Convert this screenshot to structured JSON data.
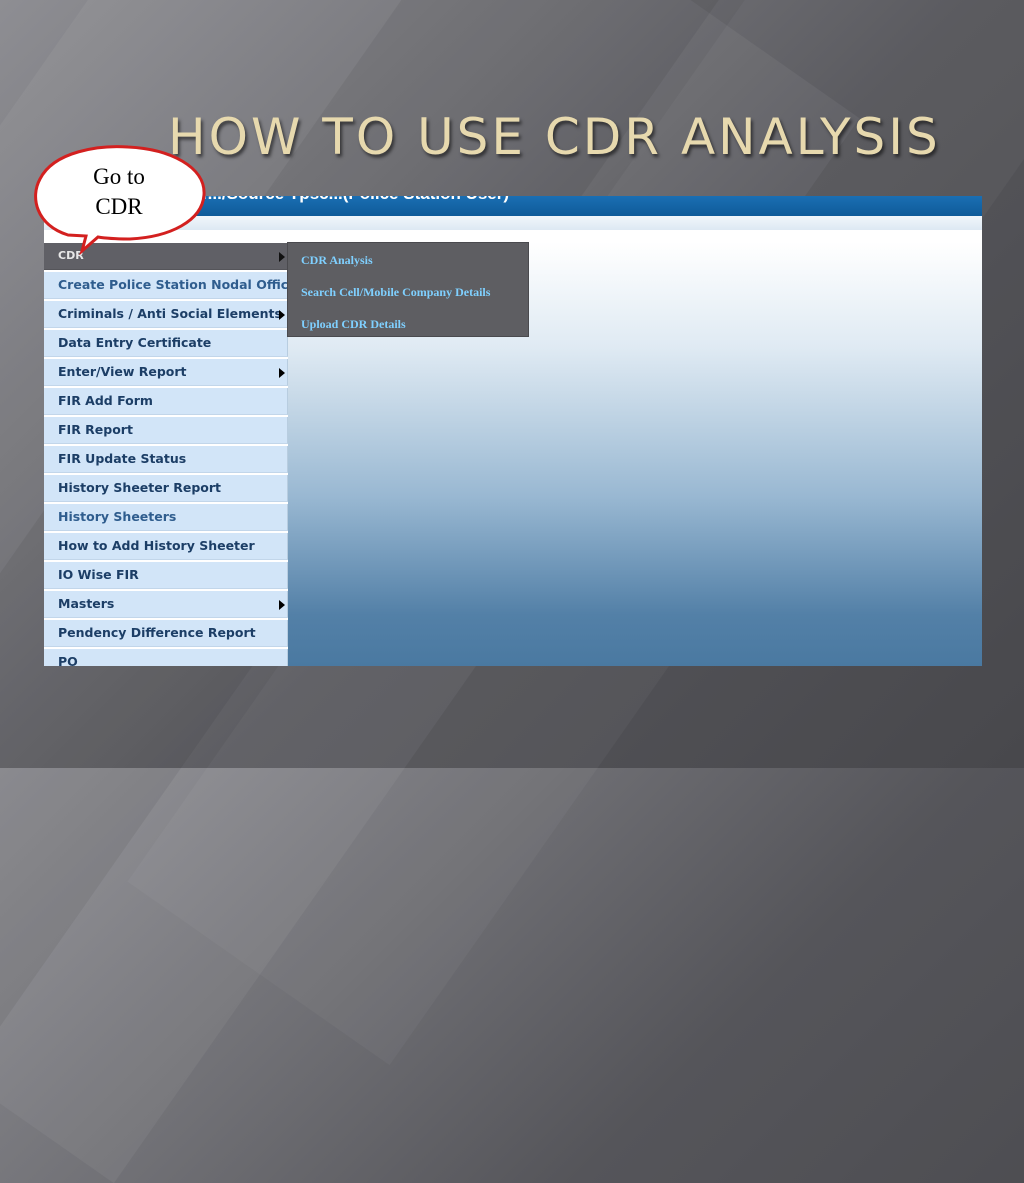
{
  "slide": {
    "title": "HOW TO USE CDR ANALYSIS"
  },
  "callout": {
    "line1": "Go to",
    "line2": "CDR",
    "border_color": "#d3201f"
  },
  "app": {
    "header_partial_text": "r.../Source Tpsc...(Police Station User)",
    "header_color": "#1566a8"
  },
  "sidebar": {
    "items": [
      {
        "label": "CDR",
        "has_submenu": true,
        "active": true
      },
      {
        "label": "Create Police Station Nodal Officer",
        "has_submenu": false
      },
      {
        "label": "Criminals / Anti Social Elements",
        "has_submenu": true
      },
      {
        "label": "Data Entry Certificate",
        "has_submenu": false
      },
      {
        "label": "Enter/View Report",
        "has_submenu": true
      },
      {
        "label": "FIR Add Form",
        "has_submenu": false
      },
      {
        "label": "FIR Report",
        "has_submenu": false
      },
      {
        "label": "FIR Update Status",
        "has_submenu": false
      },
      {
        "label": "History Sheeter Report",
        "has_submenu": false
      },
      {
        "label": "History Sheeters",
        "has_submenu": false
      },
      {
        "label": "How to Add History Sheeter",
        "has_submenu": false
      },
      {
        "label": "IO Wise FIR",
        "has_submenu": false
      },
      {
        "label": "Masters",
        "has_submenu": true
      },
      {
        "label": "Pendency Difference Report",
        "has_submenu": false
      },
      {
        "label": "PO",
        "has_submenu": false
      }
    ]
  },
  "submenu": {
    "items": [
      {
        "label": "CDR Analysis"
      },
      {
        "label": "Search Cell/Mobile Company Details"
      },
      {
        "label": "Upload CDR Details"
      }
    ],
    "text_color": "#7fd0ff",
    "background": "#5e5e62"
  },
  "colors": {
    "title": "#e7d9ae",
    "menu_bg": "#d2e5f8",
    "menu_text": "#1c3e66",
    "active_menu_bg": "#606066"
  }
}
